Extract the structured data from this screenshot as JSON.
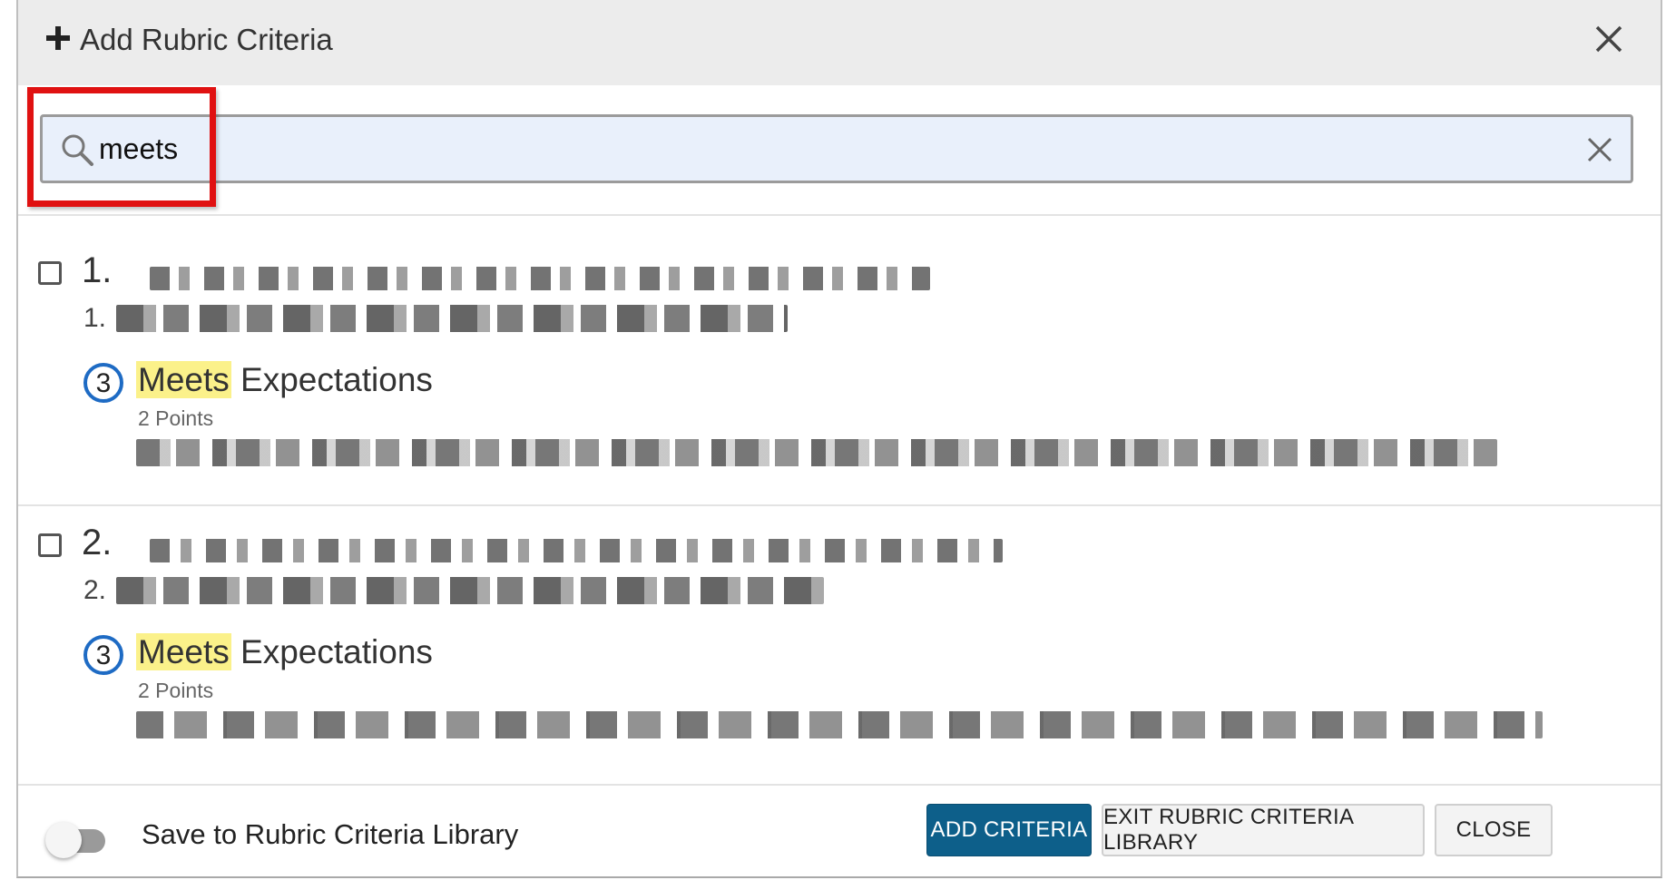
{
  "dialog": {
    "title": "Add Rubric Criteria",
    "icons": {
      "add": "plus-icon",
      "close": "close-icon"
    }
  },
  "search": {
    "value": "meets",
    "icons": {
      "search": "search-icon",
      "clear": "clear-icon"
    }
  },
  "criteria": [
    {
      "number": "1.",
      "sub_number": "1.",
      "level": {
        "badge": "3",
        "match": "Meets",
        "rest": " Expectations",
        "points": "2 Points"
      }
    },
    {
      "number": "2.",
      "sub_number": "2.",
      "level": {
        "badge": "3",
        "match": "Meets",
        "rest": " Expectations",
        "points": "2 Points"
      }
    }
  ],
  "footer": {
    "toggle_label": "Save to Rubric Criteria Library",
    "toggle_on": false,
    "buttons": {
      "add": "ADD CRITERIA",
      "exit": "EXIT RUBRIC CRITERIA LIBRARY",
      "close": "CLOSE"
    }
  },
  "colors": {
    "primary": "#0d5f8a",
    "match_highlight": "#fbf18a",
    "badge_ring": "#1e6bc4",
    "annotation_frame": "#e01111",
    "search_bg": "#e9f0fb"
  }
}
